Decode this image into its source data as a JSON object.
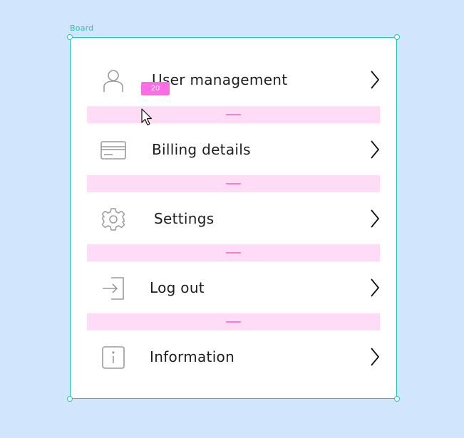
{
  "board": {
    "label": "Board",
    "spacing_badge": "20"
  },
  "menu": {
    "items": [
      {
        "label": "User management",
        "icon": "user-icon"
      },
      {
        "label": "Billing details",
        "icon": "credit-card-icon"
      },
      {
        "label": "Settings",
        "icon": "gear-icon"
      },
      {
        "label": "Log out",
        "icon": "log-out-icon"
      },
      {
        "label": "Information",
        "icon": "info-icon"
      }
    ]
  },
  "colors": {
    "background": "#d1e5fd",
    "selection": "#1fc7b0",
    "spacing_fill": "#fedcf5",
    "spacing_marker": "#f57fd9",
    "badge": "#fb6ce5",
    "text": "#1e1e1e",
    "icon": "#9a9a9a"
  }
}
